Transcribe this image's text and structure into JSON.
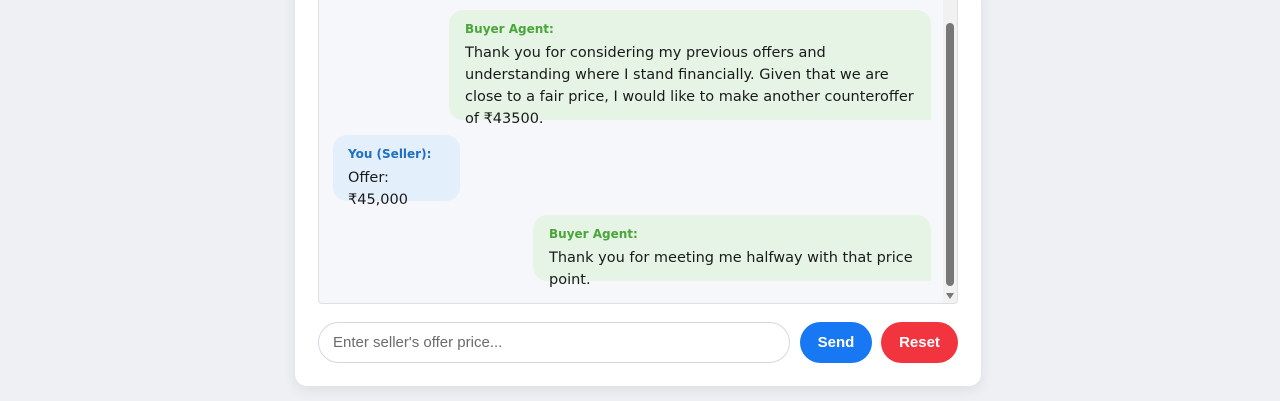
{
  "messages": [
    {
      "sender": "Buyer Agent:",
      "text": "Thank you for considering my previous offers and understanding where I stand financially. Given that we are close to a fair price, I would like to make another counteroffer of ₹43500."
    },
    {
      "sender": "You (Seller):",
      "text": "Offer: ₹45,000"
    },
    {
      "sender": "Buyer Agent:",
      "text": "Thank you for meeting me halfway with that price point."
    }
  ],
  "input": {
    "placeholder": "Enter seller's offer price...",
    "value": ""
  },
  "buttons": {
    "send_label": "Send",
    "reset_label": "Reset"
  },
  "colors": {
    "send": "#1877f2",
    "reset": "#f2343f",
    "agent_bubble": "#e6f4e6",
    "seller_bubble": "#e3effb"
  }
}
